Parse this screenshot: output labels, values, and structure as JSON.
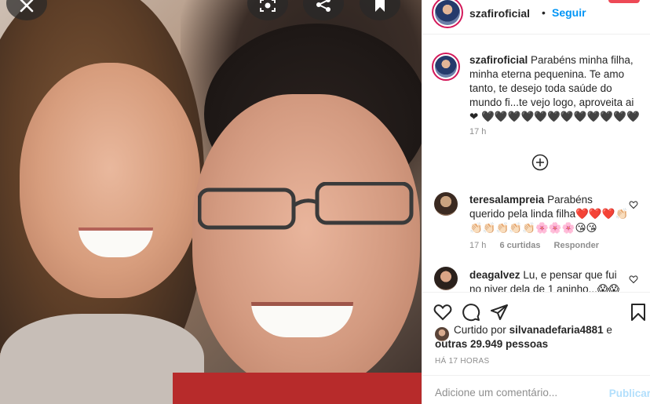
{
  "post": {
    "username": "szafiroficial",
    "follow_label": "Seguir",
    "caption": "Parabéns minha filha, minha eterna pequenina. Te amo tanto, te desejo toda saúde do mundo fi...te vejo logo, aproveita ai ❤ 🖤🖤🖤🖤🖤🖤🖤🖤🖤🖤🖤🖤",
    "caption_time": "17 h"
  },
  "comments": [
    {
      "username": "teresalampreia",
      "text": "Parabéns querido pela linda filha❤️❤️❤️👏🏻👏🏻👏🏻👏🏻👏🏻👏🏻🌸🌸🌸😘😘",
      "time": "17 h",
      "likes": "6 curtidas",
      "reply": "Responder"
    },
    {
      "username": "deagalvez",
      "text": "Lu, e pensar que fui no niver dela de 1 aninho...😱😱"
    }
  ],
  "likes": {
    "prefix": "Curtido por",
    "user": "silvanadefaria4881",
    "connector": "e",
    "others": "outras 29.949 pessoas"
  },
  "timestamp": "HÁ 17 HORAS",
  "add_comment": {
    "placeholder": "Adicione um comentário...",
    "post_label": "Publicar"
  },
  "icons": {
    "close": "close-icon",
    "lens": "lens-search-icon",
    "share": "share-icon",
    "save": "bookmark-icon",
    "like": "heart-icon",
    "comment": "comment-icon",
    "send": "send-icon",
    "load_more": "plus-circle-icon"
  },
  "colors": {
    "accent": "#0095f6",
    "ring": "#d3195a",
    "muted": "#8e8e8e",
    "post_disabled": "#b2dffc"
  }
}
